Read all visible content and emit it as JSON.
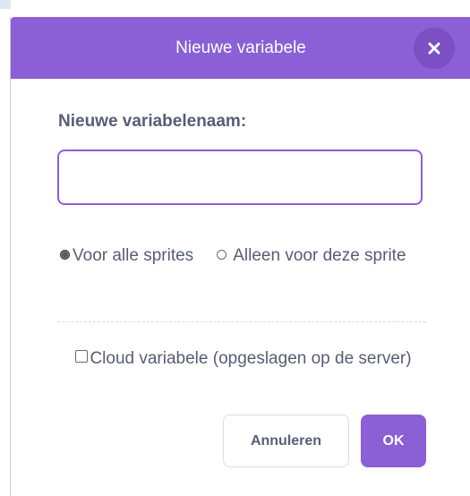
{
  "dialog": {
    "title": "Nieuwe variabele",
    "close_icon": "close-x-icon",
    "name_label": "Nieuwe variabelenaam:",
    "name_value": "",
    "scope_options": [
      {
        "label": "Voor alle sprites",
        "selected": true
      },
      {
        "label": "Alleen voor deze sprite",
        "selected": false
      }
    ],
    "cloud_label": "Cloud variabele (opgeslagen op de server)",
    "cloud_checked": false,
    "cancel_label": "Annuleren",
    "ok_label": "OK"
  },
  "colors": {
    "header": "#8b5fd6",
    "close_button": "#7a50c4",
    "accent": "#8b5fd6",
    "text": "#575e75"
  }
}
